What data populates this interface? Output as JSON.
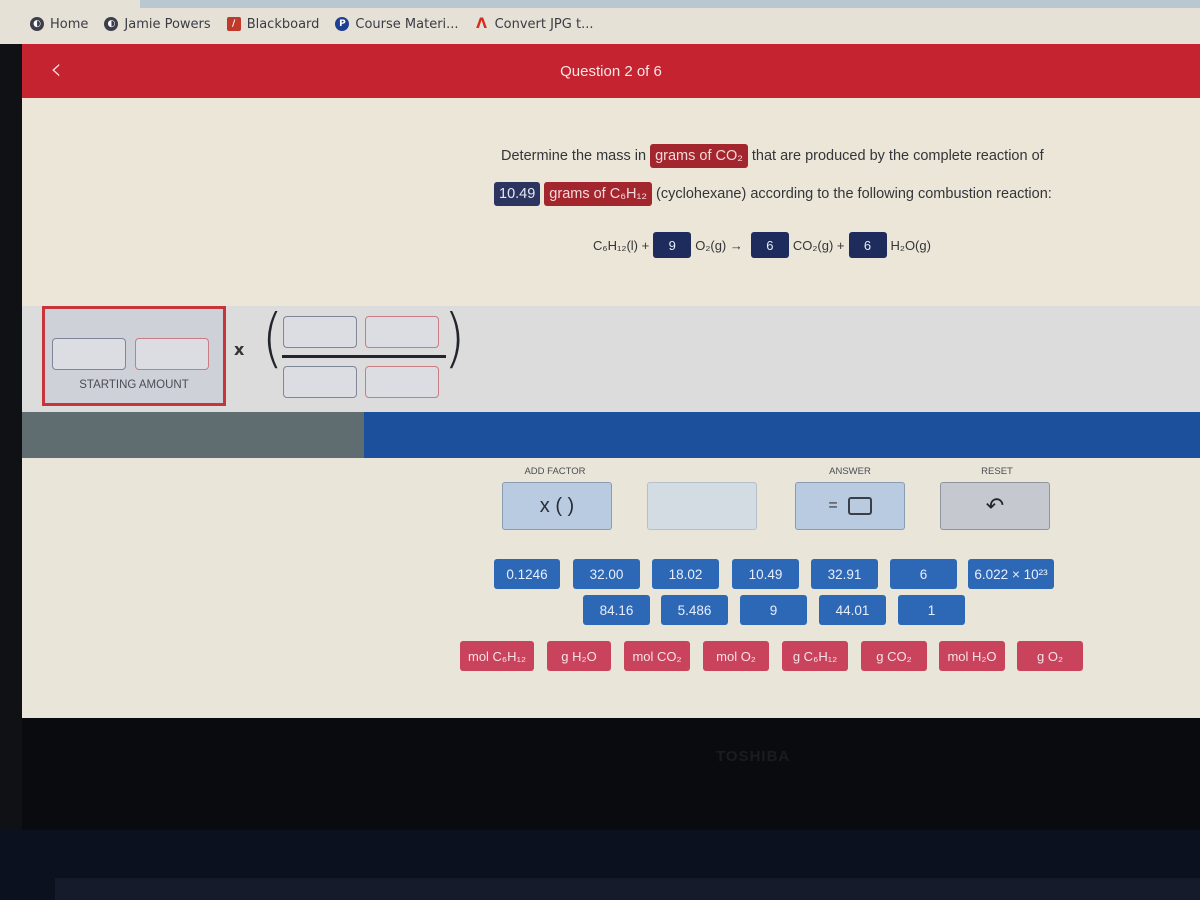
{
  "bookmarks": [
    {
      "label": "Home",
      "icon": "globe-icon"
    },
    {
      "label": "Jamie Powers",
      "icon": "globe-icon"
    },
    {
      "label": "Blackboard",
      "icon": "blackboard-icon"
    },
    {
      "label": "Course Materi...",
      "icon": "pearson-icon"
    },
    {
      "label": "Convert JPG t...",
      "icon": "adobe-icon"
    }
  ],
  "header": {
    "back_icon": "chevron-left-icon",
    "title": "Question 2 of 6"
  },
  "question": {
    "line1_prefix": "Determine the mass in",
    "line1_tag": "grams of CO₂",
    "line1_suffix": "that are produced by the complete reaction of",
    "line2_value": "10.49",
    "line2_tag": "grams of C₆H₁₂",
    "line2_suffix": "(cyclohexane) according to the following combustion reaction:"
  },
  "equation": {
    "reactant1": "C₆H₁₂(l) +",
    "coef_o2": "9",
    "reactant2": "O₂(g) →",
    "coef_co2": "6",
    "product1": "CO₂(g) +",
    "coef_h2o": "6",
    "product2": "H₂O(g)"
  },
  "workspace": {
    "starting_amount_label": "STARTING AMOUNT",
    "times_symbol": "x"
  },
  "progress": {
    "completed_fraction": 0.29
  },
  "controls": {
    "add_factor_label": "ADD FACTOR",
    "add_factor_symbol": "x (   )",
    "answer_label": "ANSWER",
    "answer_symbol": "=",
    "reset_label": "RESET",
    "reset_icon": "undo-icon"
  },
  "number_tiles_row1": [
    "0.1246",
    "32.00",
    "18.02",
    "10.49",
    "32.91",
    "6",
    "6.022 × 10²³"
  ],
  "number_tiles_row2": [
    "84.16",
    "5.486",
    "9",
    "44.01",
    "1"
  ],
  "unit_tiles": [
    "mol C₆H₁₂",
    "g H₂O",
    "mol CO₂",
    "mol O₂",
    "g C₆H₁₂",
    "g CO₂",
    "mol H₂O",
    "g O₂"
  ],
  "bezel": {
    "brand": "TOSHIBA"
  },
  "colors": {
    "header_red": "#c4232f",
    "tag_red": "#a3262e",
    "tag_navy": "#2c3560",
    "number_tile_blue": "#2d68b6",
    "unit_tile_red": "#c9435c",
    "progress_blue": "#1c4f9c",
    "progress_gray": "#5f6d70"
  }
}
